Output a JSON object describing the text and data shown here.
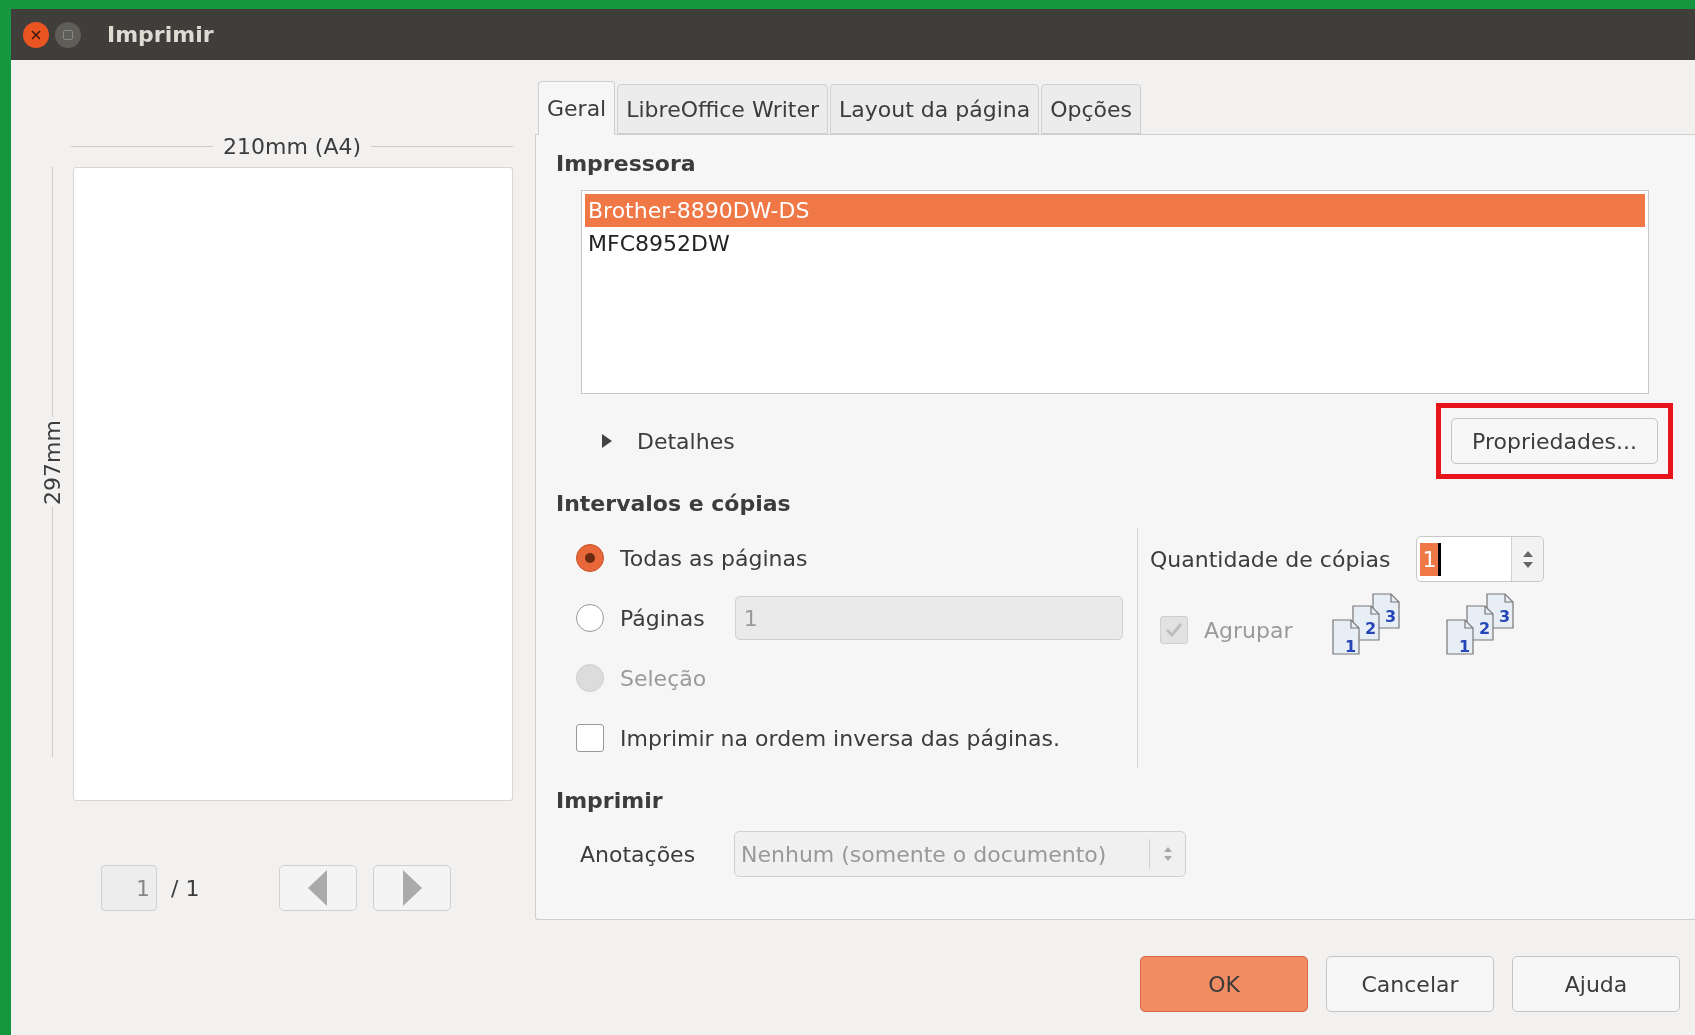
{
  "window": {
    "title": "Imprimir"
  },
  "preview": {
    "width_label": "210mm (A4)",
    "height_label": "297mm",
    "page_value": "1",
    "page_total": "/ 1"
  },
  "tabs": [
    {
      "label": "Geral",
      "selected": true
    },
    {
      "label": "LibreOffice Writer",
      "selected": false
    },
    {
      "label": "Layout da página",
      "selected": false
    },
    {
      "label": "Opções",
      "selected": false
    }
  ],
  "printer": {
    "heading": "Impressora",
    "printers": [
      {
        "name": "Brother-8890DW-DS",
        "selected": true
      },
      {
        "name": "MFC8952DW",
        "selected": false
      }
    ],
    "details": {
      "label": "Detalhes",
      "expanded": false
    },
    "properties_button": "Propriedades...",
    "properties_highlighted": true
  },
  "ranges": {
    "heading": "Intervalos e cópias",
    "options": [
      {
        "kind": "radio",
        "label": "Todas as páginas",
        "selected": true,
        "disabled": false
      },
      {
        "kind": "radio-field",
        "label": "Páginas",
        "selected": false,
        "disabled": false,
        "value": "1"
      },
      {
        "kind": "radio",
        "label": "Seleção",
        "selected": false,
        "disabled": true
      },
      {
        "kind": "checkbox",
        "label": "Imprimir na ordem inversa das páginas.",
        "selected": false,
        "disabled": false
      }
    ]
  },
  "copies": {
    "label": "Quantidade de cópias",
    "value": "1",
    "collate": {
      "label": "Agrupar",
      "checked": true,
      "disabled": true
    },
    "collate_icons": [
      {
        "pages": [
          "1",
          "2",
          "3"
        ]
      },
      {
        "pages": [
          "1",
          "2",
          "3"
        ]
      }
    ]
  },
  "print": {
    "heading": "Imprimir",
    "annotations_label": "Anotações",
    "annotations_value": "Nenhum (somente o documento)"
  },
  "buttons": [
    {
      "label": "OK",
      "primary": true
    },
    {
      "label": "Cancelar",
      "primary": false
    },
    {
      "label": "Ajuda",
      "primary": false
    }
  ]
}
